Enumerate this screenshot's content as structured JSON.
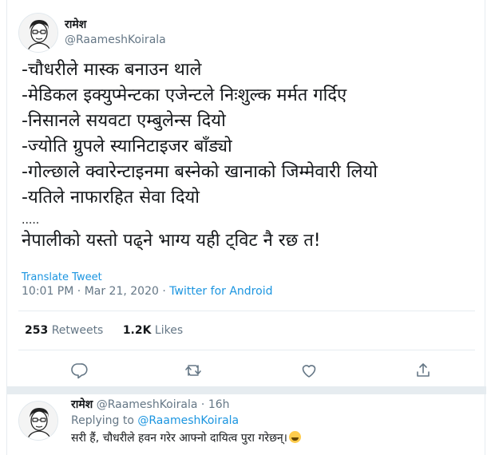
{
  "tweet": {
    "display_name": "रामेश",
    "handle": "@RaameshKoirala",
    "lines": [
      "-चौधरीले मास्क बनाउन थाले",
      "-मेडिकल इक्युप्मेन्टका एजेन्टले निःशुल्क मर्मत गर्दिए",
      "-निसानले सयवटा एम्बुलेन्स दियो",
      "-ज्योति ग्रुपले स्यानिटाइजर बाँड्यो",
      "-गोल्छाले क्वारेन्टाइनमा बस्नेको खानाको जिम्मेवारी लियो",
      "-यतिले नाफारहित सेवा दियो"
    ],
    "dots": ".....",
    "closing": "नेपालीको यस्तो पढ्ने भाग्य यही ट्विट नै रछ त!",
    "translate_label": "Translate Tweet",
    "time": "10:01 PM",
    "dot_sep": "·",
    "date": "Mar 21, 2020",
    "source": "Twitter for Android",
    "retweets_count": "253",
    "retweets_label": "Retweets",
    "likes_count": "1.2K",
    "likes_label": "Likes"
  },
  "actions": {
    "icons": [
      "reply-icon",
      "retweet-icon",
      "like-icon",
      "share-icon"
    ],
    "color": "#657786"
  },
  "reply": {
    "display_name": "रामेश",
    "handle": "@RaameshKoirala",
    "dot_sep": "·",
    "time": "16h",
    "replying_prefix": "Replying to",
    "replying_to": "@RaameshKoirala",
    "text": "सरी हैं, चौधरीले हवन गरेर आफ्नो दायित्व पुरा गरेछन्।",
    "emoji": "face-with-tears-of-joy-emoji"
  },
  "colors": {
    "link": "#1b95e0",
    "muted": "#657786",
    "text": "#14171a",
    "border": "#e6ecf0"
  }
}
